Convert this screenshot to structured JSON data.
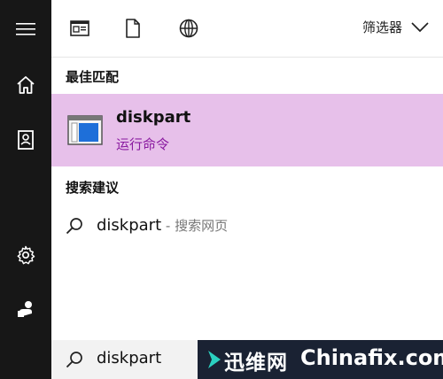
{
  "rail": {
    "items": [
      "menu-icon",
      "home-icon",
      "notebook-icon",
      "gear-icon",
      "user-icon"
    ]
  },
  "topbar": {
    "filter_label": "筛选器"
  },
  "best_match": {
    "section_title": "最佳匹配",
    "name": "diskpart",
    "subtitle": "运行命令"
  },
  "suggestions": {
    "section_title": "搜索建议",
    "item_text": "diskpart",
    "item_hint": " - 搜索网页"
  },
  "search": {
    "value": "diskpart"
  },
  "watermark": {
    "cn": "迅维网",
    "en": "Chinafix.com"
  },
  "colors": {
    "rail_bg": "#171717",
    "highlight_bg": "#e7c0ea",
    "subtitle_color": "#8a1aa0",
    "searchbar_bg": "#f2f2f2",
    "watermark_bg": "#1a2233"
  }
}
